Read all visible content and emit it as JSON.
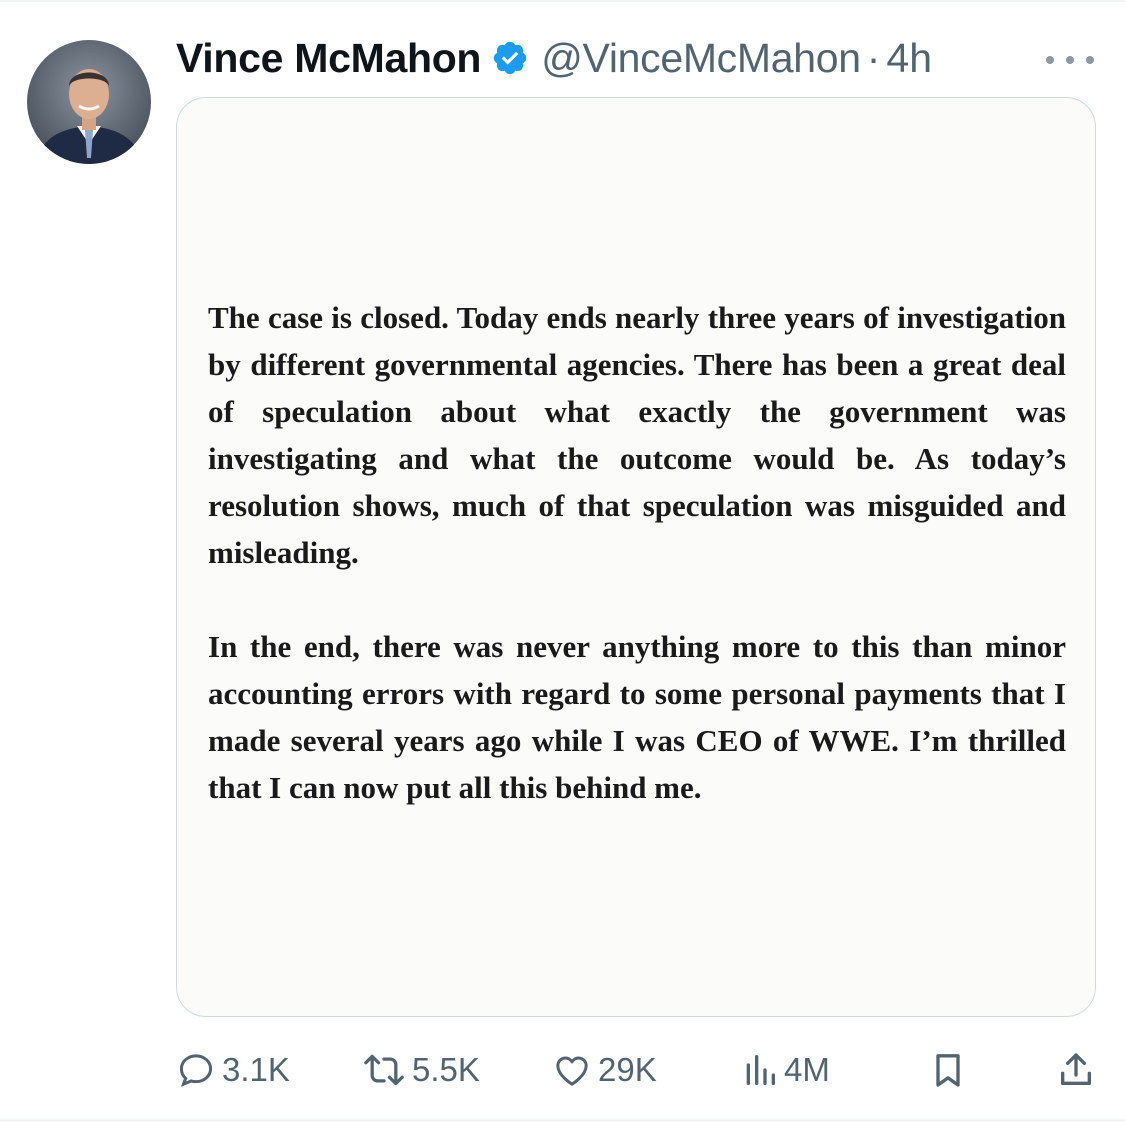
{
  "tweet": {
    "author_name": "Vince McMahon",
    "handle": "@VinceMcMahon",
    "separator": "·",
    "time": "4h",
    "verified_color": "#1d9bf0",
    "avatar_icon": "profile-photo-icon",
    "more_icon": "more-options-icon"
  },
  "statement": {
    "paragraph_1": "The case is closed. Today ends nearly three years of investigation by different governmental agencies. There has been a great deal of speculation about what exactly the government was investigating and what the outcome would be. As today’s resolution shows, much of that speculation was misguided and misleading.",
    "paragraph_2": "In the end, there was never anything more to this than minor accounting errors with regard to some personal payments that I made several years ago while I was CEO of WWE. I’m thrilled that I can now put all this behind me."
  },
  "actions": {
    "replies": {
      "icon": "reply-icon",
      "count": "3.1K"
    },
    "reposts": {
      "icon": "repost-icon",
      "count": "5.5K"
    },
    "likes": {
      "icon": "heart-icon",
      "count": "29K"
    },
    "views": {
      "icon": "views-icon",
      "count": "4M"
    },
    "bookmark": {
      "icon": "bookmark-icon"
    },
    "share": {
      "icon": "share-icon"
    }
  }
}
